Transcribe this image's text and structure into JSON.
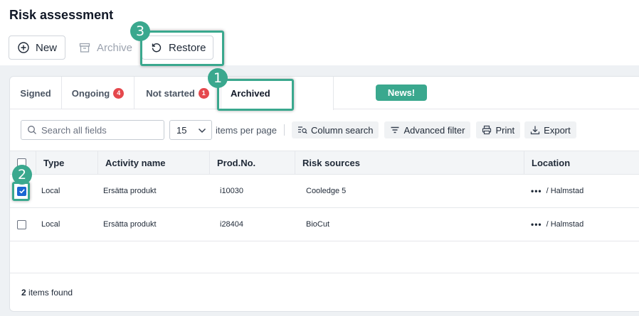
{
  "page": {
    "title": "Risk assessment"
  },
  "toolbar": {
    "new_label": "New",
    "archive_label": "Archive",
    "restore_label": "Restore"
  },
  "tabs": [
    {
      "label": "Signed"
    },
    {
      "label": "Ongoing",
      "badge": "4"
    },
    {
      "label": "Not started",
      "badge": "1"
    },
    {
      "label": "Archived",
      "active": true
    }
  ],
  "news_badge": "News!",
  "filters": {
    "search_placeholder": "Search all fields",
    "per_page_value": "15",
    "per_page_label": "items per page",
    "column_search": "Column search",
    "advanced_filter": "Advanced filter",
    "print": "Print",
    "export": "Export"
  },
  "table": {
    "columns": [
      "Type",
      "Activity name",
      "Prod.No.",
      "Risk sources",
      "Location"
    ],
    "rows": [
      {
        "checked": true,
        "type": "Local",
        "activity": "Ersätta produkt",
        "prod_no": "i10030",
        "risk_sources": "Cooledge 5",
        "location_dots": "•••",
        "location": "/ Halmstad"
      },
      {
        "checked": false,
        "type": "Local",
        "activity": "Ersätta produkt",
        "prod_no": "i28404",
        "risk_sources": "BioCut",
        "location_dots": "•••",
        "location": "/ Halmstad"
      }
    ]
  },
  "footer": {
    "count": "2",
    "items_found": "items found"
  },
  "annotations": {
    "step1": "1",
    "step2": "2",
    "step3": "3"
  },
  "colors": {
    "accent": "#3aa88e",
    "badge": "#e5484d",
    "checkbox": "#1a66d2"
  },
  "icons": [
    "plus-circle-icon",
    "archive-box-icon",
    "restore-icon",
    "search-icon",
    "chevron-down-icon",
    "column-search-icon",
    "filter-icon",
    "printer-icon",
    "download-icon",
    "check-icon"
  ]
}
